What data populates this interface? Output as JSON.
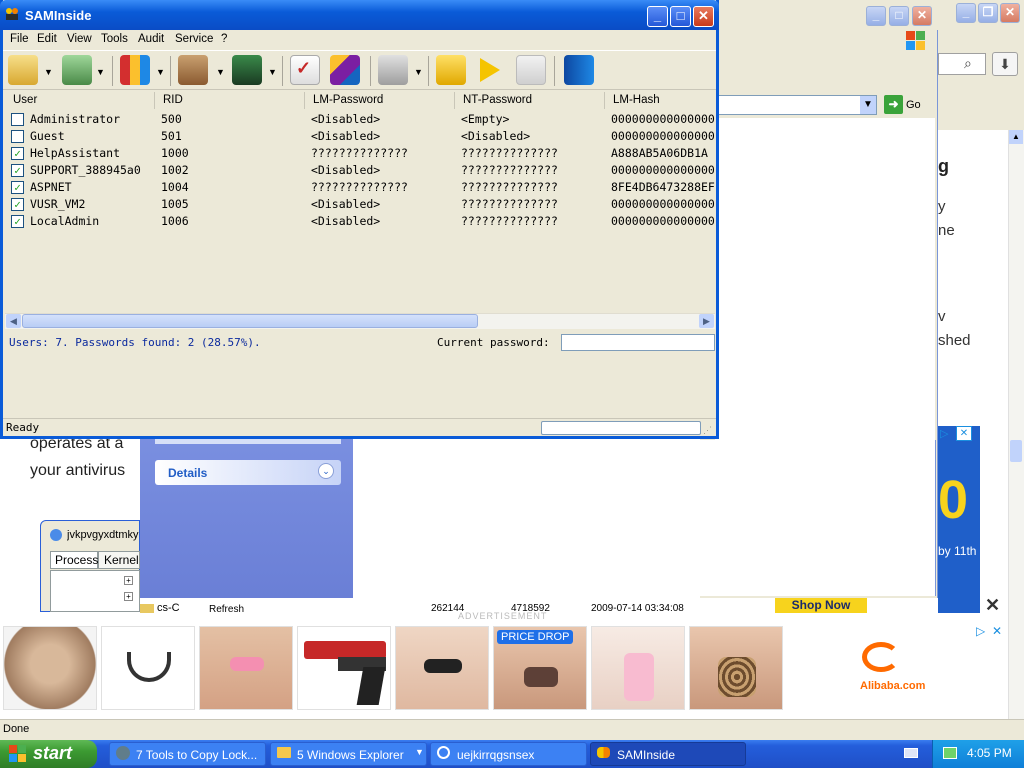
{
  "samwindow": {
    "title": "SAMInside",
    "menu": [
      "File",
      "Edit",
      "View",
      "Tools",
      "Audit",
      "Service",
      "?"
    ],
    "columns": [
      "User",
      "RID",
      "LM-Password",
      "NT-Password",
      "LM-Hash"
    ],
    "rows": [
      {
        "user": "Administrator",
        "rid": "500",
        "lm": "<Disabled>",
        "nt": "<Empty>",
        "hash": "000000000000000",
        "checked": false
      },
      {
        "user": "Guest",
        "rid": "501",
        "lm": "<Disabled>",
        "nt": "<Disabled>",
        "hash": "000000000000000",
        "checked": false
      },
      {
        "user": "HelpAssistant",
        "rid": "1000",
        "lm": "??????????????",
        "nt": "??????????????",
        "hash": "A888AB5A06DB1A",
        "checked": true
      },
      {
        "user": "SUPPORT_388945a0",
        "rid": "1002",
        "lm": "<Disabled>",
        "nt": "??????????????",
        "hash": "000000000000000",
        "checked": true
      },
      {
        "user": "ASPNET",
        "rid": "1004",
        "lm": "??????????????",
        "nt": "??????????????",
        "hash": "8FE4DB6473288EF",
        "checked": true
      },
      {
        "user": "VUSR_VM2",
        "rid": "1005",
        "lm": "<Disabled>",
        "nt": "??????????????",
        "hash": "000000000000000",
        "checked": true
      },
      {
        "user": "LocalAdmin",
        "rid": "1006",
        "lm": "<Disabled>",
        "nt": "??????????????",
        "hash": "000000000000000",
        "checked": true
      }
    ],
    "summary": "Users: 7. Passwords found: 2 (28.57%).",
    "current_password_label": "Current password:",
    "current_password_value": "",
    "status": "Ready"
  },
  "browser": {
    "go_label": "Go",
    "details_label": "Details",
    "article_line1": "operates at a",
    "article_line2": "your antivirus",
    "right_frag": [
      "g",
      "y",
      "ne",
      "v",
      "shed"
    ],
    "ad_frag_date": "by 11th",
    "shop_now": "Shop Now",
    "advertisement": "ADVERTISEMENT",
    "price_drop": "PRICE DROP",
    "alibaba": "Alibaba.com",
    "status_done": "Done"
  },
  "process_window": {
    "title": "jvkpvgyxdtmky",
    "tabs": [
      "Process",
      "Kernel"
    ],
    "tree_item": "cs-C",
    "row_label": "Refresh",
    "row_val1": "262144",
    "row_val2": "4718592",
    "row_date": "2009-07-14 03:34:08"
  },
  "taskbar": {
    "start": "start",
    "items": [
      "7 Tools to Copy Lock...",
      "5 Windows Explorer",
      "uejkirrqgsnsex",
      "SAMInside"
    ],
    "clock": "4:05 PM"
  },
  "colors": {
    "xp_title": "#0a5bd8",
    "taskbar": "#245edb",
    "start": "#3c9a32",
    "summary_text": "#0b2a9e",
    "check": "#21a121"
  }
}
